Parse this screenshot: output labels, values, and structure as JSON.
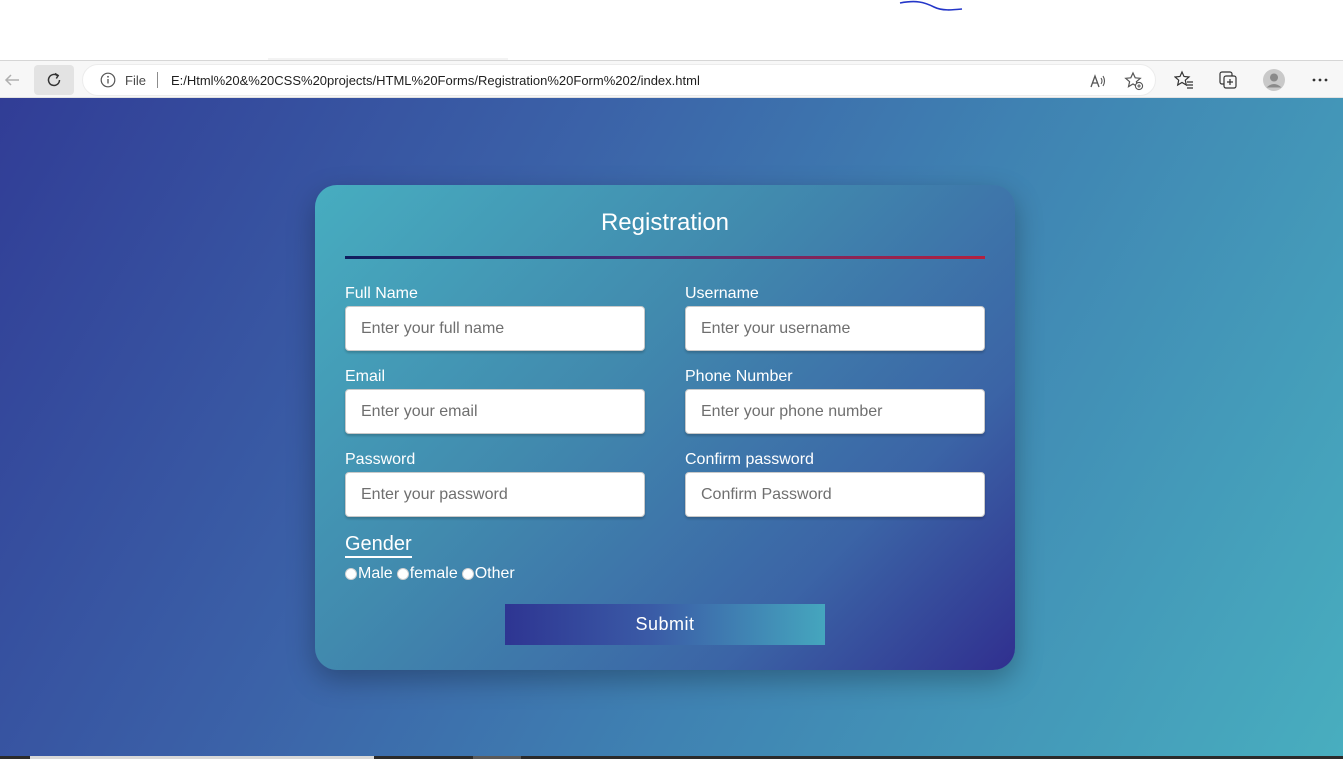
{
  "browser": {
    "address_prefix": "File",
    "url": "E:/Html%20&%20CSS%20projects/HTML%20Forms/Registration%20Form%202/index.html"
  },
  "form": {
    "title": "Registration",
    "fields": [
      {
        "label": "Full Name",
        "placeholder": "Enter your full name"
      },
      {
        "label": "Username",
        "placeholder": "Enter your username"
      },
      {
        "label": "Email",
        "placeholder": "Enter your email"
      },
      {
        "label": "Phone Number",
        "placeholder": "Enter your phone number"
      },
      {
        "label": "Password",
        "placeholder": "Enter your password"
      },
      {
        "label": "Confirm password",
        "placeholder": "Confirm Password"
      }
    ],
    "gender": {
      "title": "Gender",
      "options": [
        "Male",
        "female",
        "Other"
      ]
    },
    "submit_label": "Submit"
  },
  "colors": {
    "page_gradient": [
      "#313d96",
      "#48aebf"
    ],
    "title_rule": [
      "#101e5e",
      "#b3213f"
    ]
  }
}
